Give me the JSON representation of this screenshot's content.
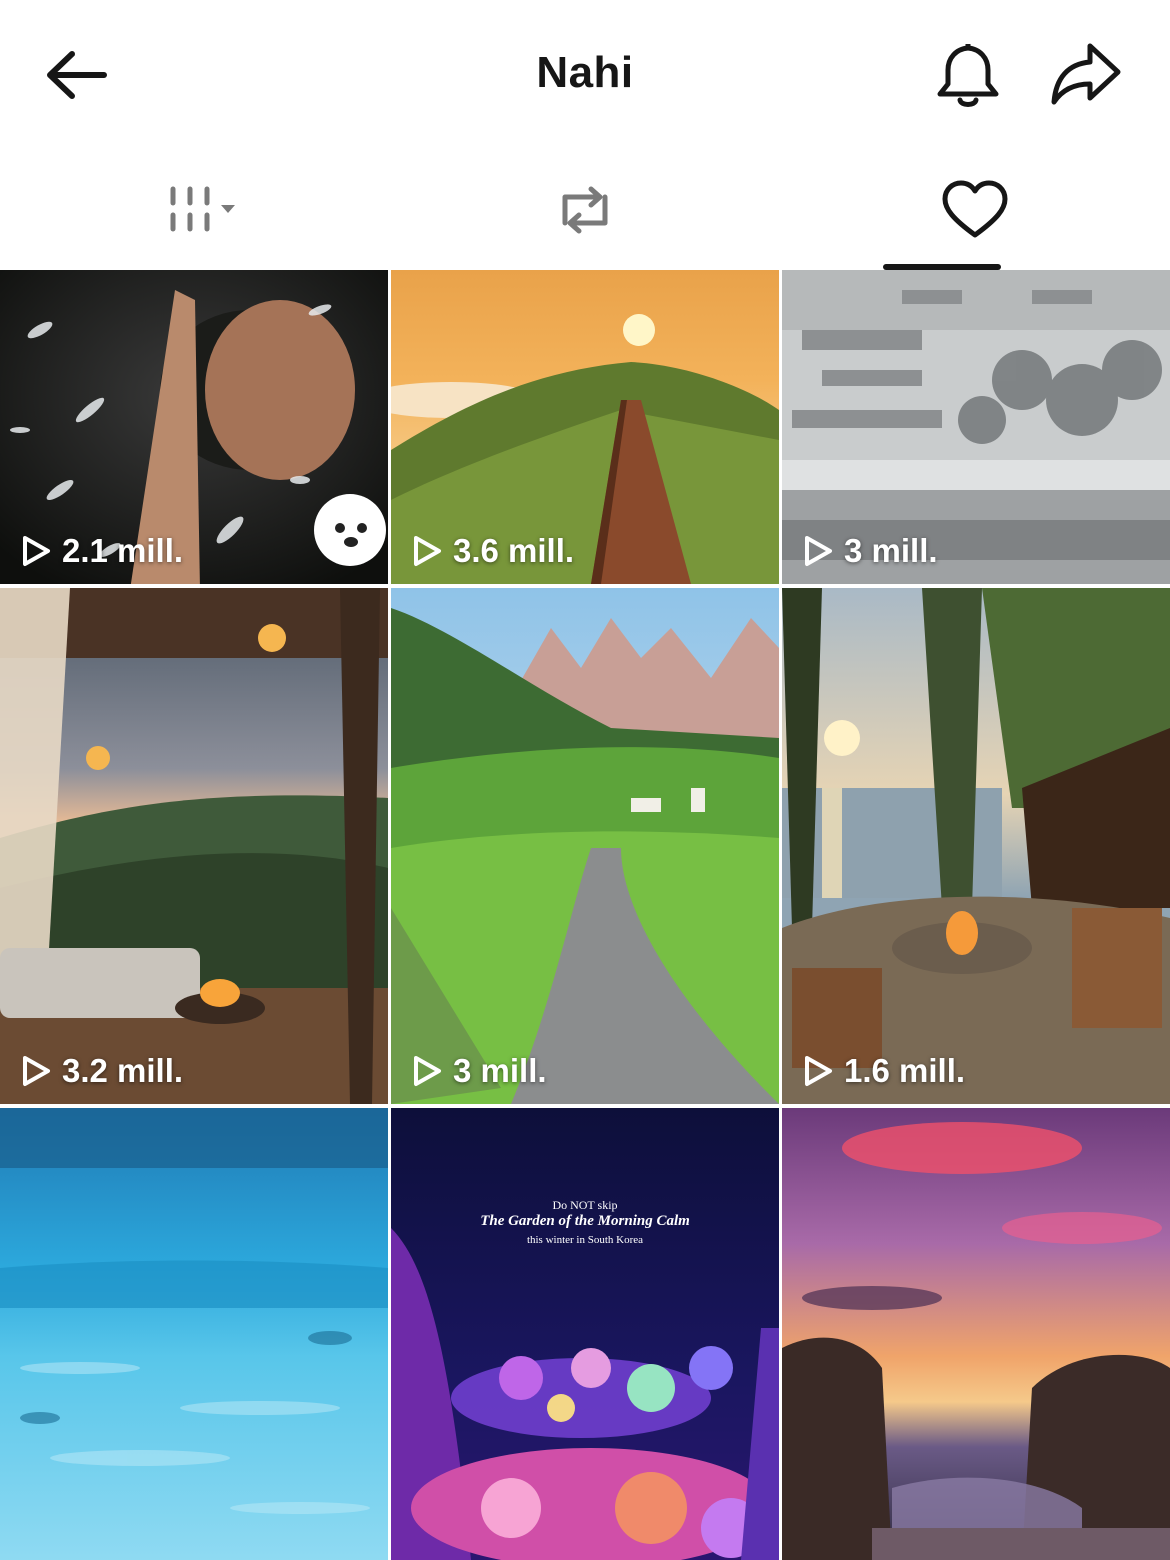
{
  "header": {
    "title": "Nahi"
  },
  "tabs": [
    {
      "name": "videos",
      "icon": "grid-columns-icon",
      "has_dropdown": true,
      "active": false
    },
    {
      "name": "reposts",
      "icon": "repost-icon",
      "active": false
    },
    {
      "name": "liked",
      "icon": "heart-icon",
      "active": true
    }
  ],
  "videos": [
    {
      "views": "2.1 mill."
    },
    {
      "views": "3.6 mill."
    },
    {
      "views": "3 mill."
    },
    {
      "views": "3.2 mill."
    },
    {
      "views": "3 mill."
    },
    {
      "views": "1.6 mill."
    },
    {
      "views": null
    },
    {
      "views": null,
      "overlay": {
        "line1": "Do NOT skip",
        "line2": "The Garden of the Morning Calm",
        "line3": "this winter in South Korea"
      }
    },
    {
      "views": null
    }
  ],
  "colors": {
    "icon": "#161616",
    "tab_icon_inactive": "#7a7a7a",
    "background": "#ffffff"
  }
}
